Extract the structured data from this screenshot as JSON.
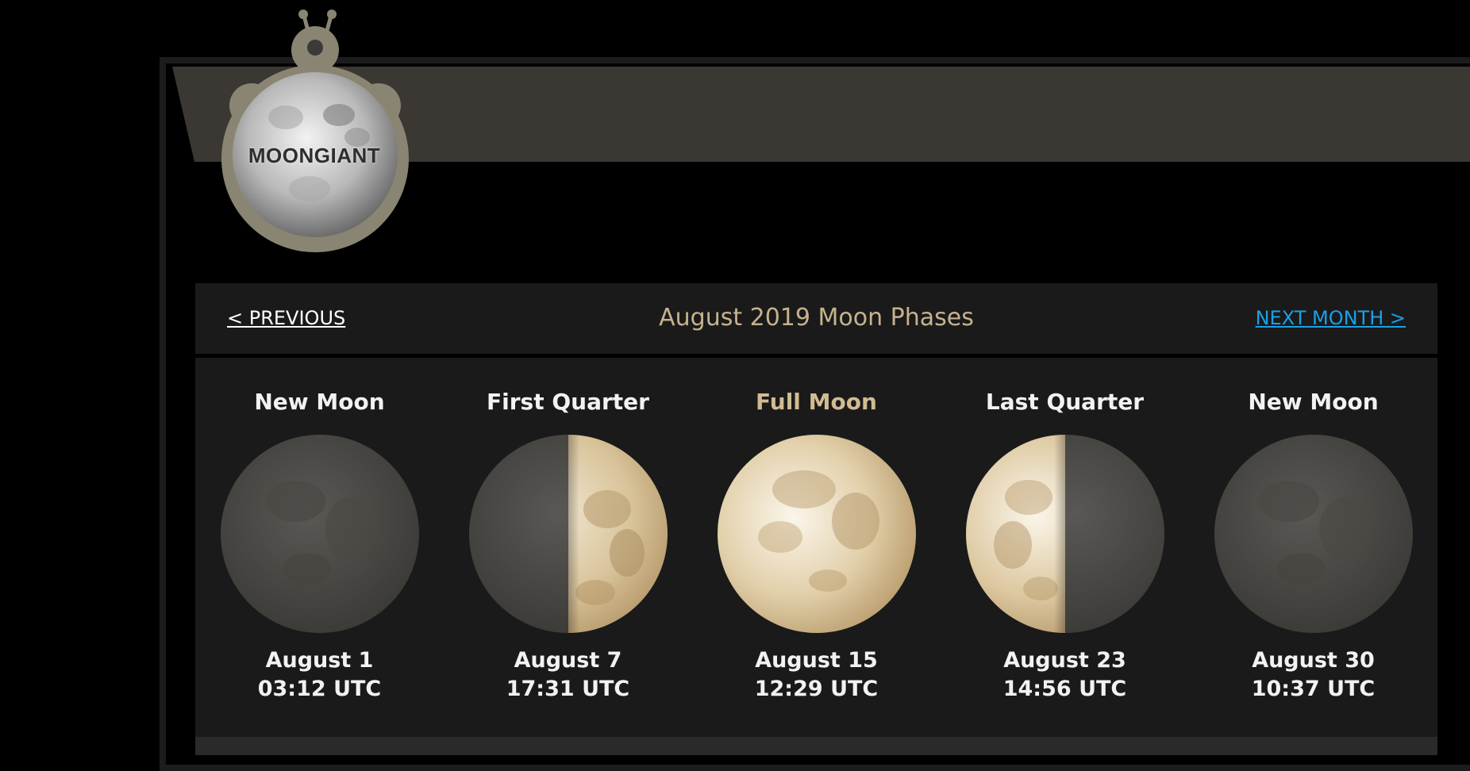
{
  "logo": {
    "text": "MOONGIANT"
  },
  "nav": {
    "prev_label": "< PREVIOUS",
    "title": "August 2019 Moon Phases",
    "next_label": "NEXT MONTH >"
  },
  "phases": [
    {
      "name": "New Moon",
      "date": "August 1",
      "time": "03:12 UTC",
      "icon": "new-moon"
    },
    {
      "name": "First Quarter",
      "date": "August 7",
      "time": "17:31 UTC",
      "icon": "first-quarter-moon"
    },
    {
      "name": "Full Moon",
      "date": "August 15",
      "time": "12:29 UTC",
      "icon": "full-moon"
    },
    {
      "name": "Last Quarter",
      "date": "August 23",
      "time": "14:56 UTC",
      "icon": "last-quarter-moon"
    },
    {
      "name": "New Moon",
      "date": "August 30",
      "time": "10:37 UTC",
      "icon": "new-moon"
    }
  ],
  "colors": {
    "background": "#000000",
    "panel": "#1a1a1a",
    "header_band": "#3b3733",
    "title_gold": "#c7b28e",
    "link_blue": "#1aa0e8"
  }
}
